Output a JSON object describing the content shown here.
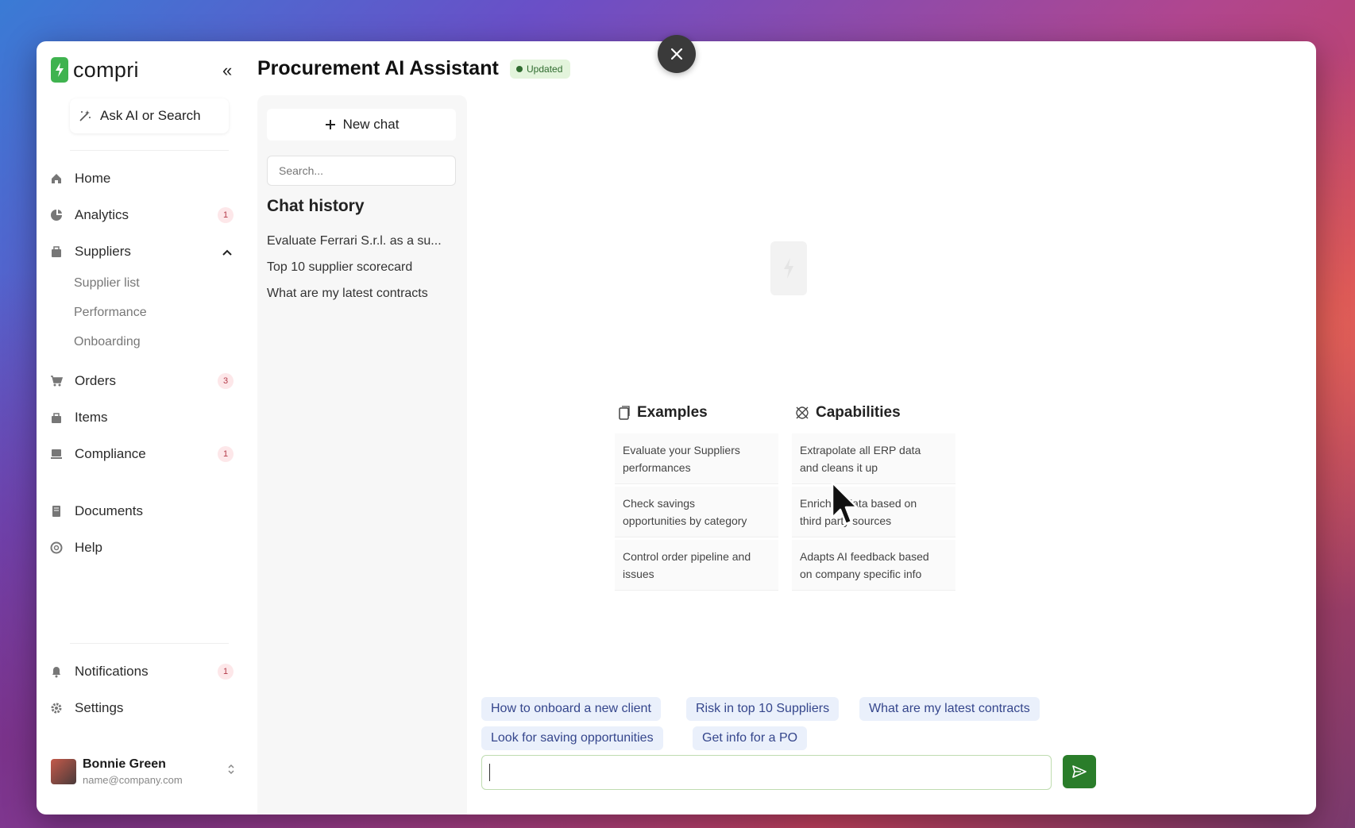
{
  "close_button": {
    "icon": "close-icon"
  },
  "sidebar": {
    "logo_text": "compri",
    "collapse_icon": "«",
    "ask_label": "Ask AI or Search",
    "nav": [
      {
        "label": "Home",
        "icon": "home-icon",
        "badge": ""
      },
      {
        "label": "Analytics",
        "icon": "analytics-icon",
        "badge": "1"
      },
      {
        "label": "Suppliers",
        "icon": "suppliers-icon",
        "badge": ""
      },
      {
        "label": "Orders",
        "icon": "cart-icon",
        "badge": "3"
      },
      {
        "label": "Items",
        "icon": "items-icon",
        "badge": ""
      },
      {
        "label": "Compliance",
        "icon": "compliance-icon",
        "badge": "1"
      },
      {
        "label": "Documents",
        "icon": "documents-icon",
        "badge": ""
      },
      {
        "label": "Help",
        "icon": "help-icon",
        "badge": ""
      }
    ],
    "suppliers_sub": [
      "Supplier list",
      "Performance",
      "Onboarding"
    ],
    "bottom": [
      {
        "label": "Notifications",
        "icon": "bell-icon",
        "badge": "1"
      },
      {
        "label": "Settings",
        "icon": "gear-icon",
        "badge": ""
      }
    ],
    "user": {
      "name": "Bonnie Green",
      "email": "name@company.com"
    }
  },
  "header": {
    "title": "Procurement AI Assistant",
    "status": "Updated"
  },
  "chat_panel": {
    "new_chat_label": "New chat",
    "search_placeholder": "Search...",
    "history_title": "Chat history",
    "history": [
      "Evaluate Ferrari S.r.l. as a su...",
      "Top 10 supplier scorecard",
      "What are my latest contracts"
    ]
  },
  "main": {
    "examples_title": "Examples",
    "examples": [
      [
        "Evaluate your Suppliers",
        "performances"
      ],
      [
        "Check savings",
        "opportunities by category"
      ],
      [
        "Control order pipeline and",
        "issues"
      ]
    ],
    "capabilities_title": "Capabilities",
    "capabilities": [
      [
        "Extrapolate all ERP data",
        "and cleans it up"
      ],
      [
        "Enriches data based on",
        "third party sources"
      ],
      [
        "Adapts AI feedback based",
        "on company specific info"
      ]
    ],
    "suggestions": [
      "How to onboard a new client",
      "Risk in top 10 Suppliers",
      "What are my latest contracts",
      "Look for saving opportunities",
      "Get info for a PO"
    ],
    "composer_value": ""
  },
  "colors": {
    "brand_green": "#3fb34f",
    "send_green": "#2a7d2a",
    "chip_bg": "#eaf0fb",
    "badge_red": "#b43b4a"
  }
}
